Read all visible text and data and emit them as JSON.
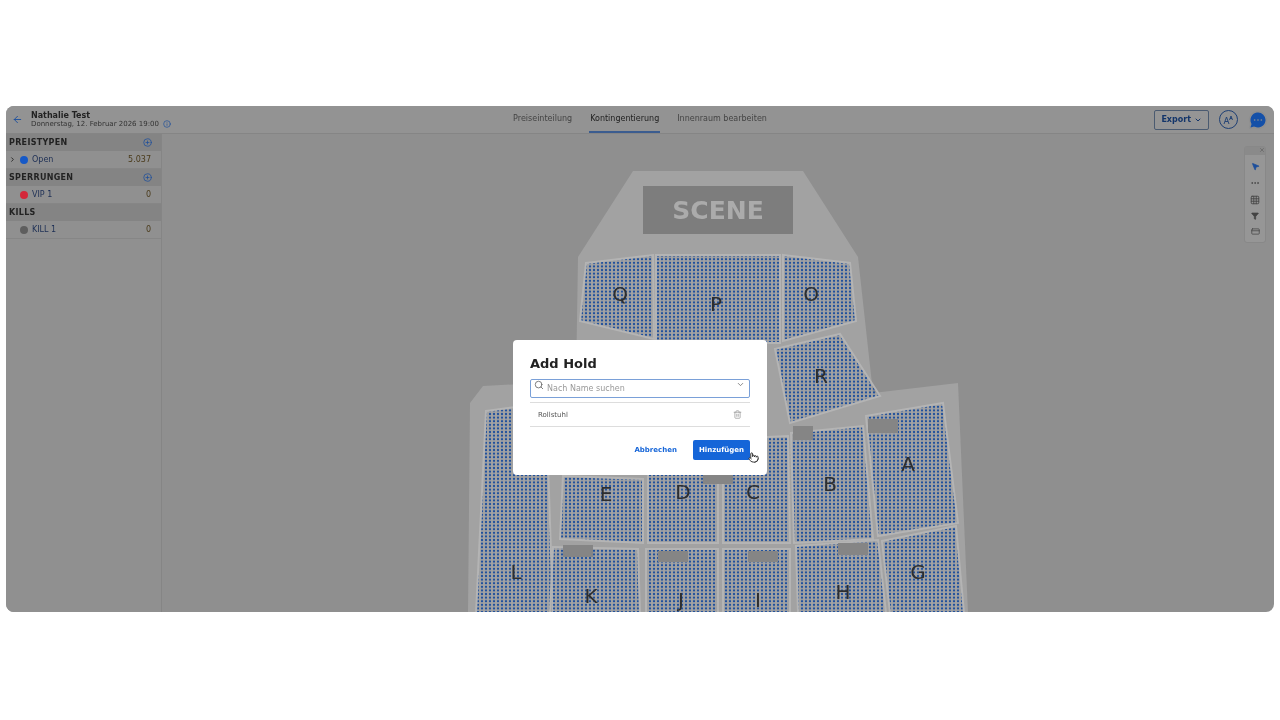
{
  "header": {
    "title": "Nathalie Test",
    "subtitle": "Donnerstag, 12. Februar 2026 19:00",
    "tabs": [
      {
        "label": "Preiseinteilung",
        "selected": false
      },
      {
        "label": "Kontingentierung",
        "selected": true
      },
      {
        "label": "Innenraum bearbeiten",
        "selected": false
      }
    ],
    "export_button": "Export"
  },
  "sidebar": {
    "groups": [
      {
        "title": "PREISTYPEN",
        "addable": true,
        "items": [
          {
            "name": "Open",
            "count": "5.037",
            "color": "#1659c7",
            "expandable": true
          }
        ]
      },
      {
        "title": "SPERRUNGEN",
        "addable": true,
        "items": [
          {
            "name": "VIP 1",
            "count": "0",
            "color": "#d3283a",
            "expandable": false
          }
        ]
      },
      {
        "title": "KILLS",
        "addable": false,
        "items": [
          {
            "name": "KILL 1",
            "count": "0",
            "color": "#5e5e5e",
            "expandable": false
          }
        ]
      }
    ]
  },
  "seat_map": {
    "stage": "SCENE",
    "sections": [
      {
        "label": "Q"
      },
      {
        "label": "P"
      },
      {
        "label": "O"
      },
      {
        "label": "R"
      },
      {
        "label": "E"
      },
      {
        "label": "D"
      },
      {
        "label": "C"
      },
      {
        "label": "B"
      },
      {
        "label": "A"
      },
      {
        "label": "L"
      },
      {
        "label": "K"
      },
      {
        "label": "J"
      },
      {
        "label": "I"
      },
      {
        "label": "H"
      },
      {
        "label": "G"
      }
    ]
  },
  "dialog": {
    "title": "Add Hold",
    "search": {
      "placeholder": "Nach Name suchen"
    },
    "items": [
      {
        "name": "Rollstuhl"
      }
    ],
    "buttons": [
      {
        "label": "Abbrechen",
        "kind": "text"
      },
      {
        "label": "Hinzufügen",
        "kind": "primary"
      }
    ]
  }
}
